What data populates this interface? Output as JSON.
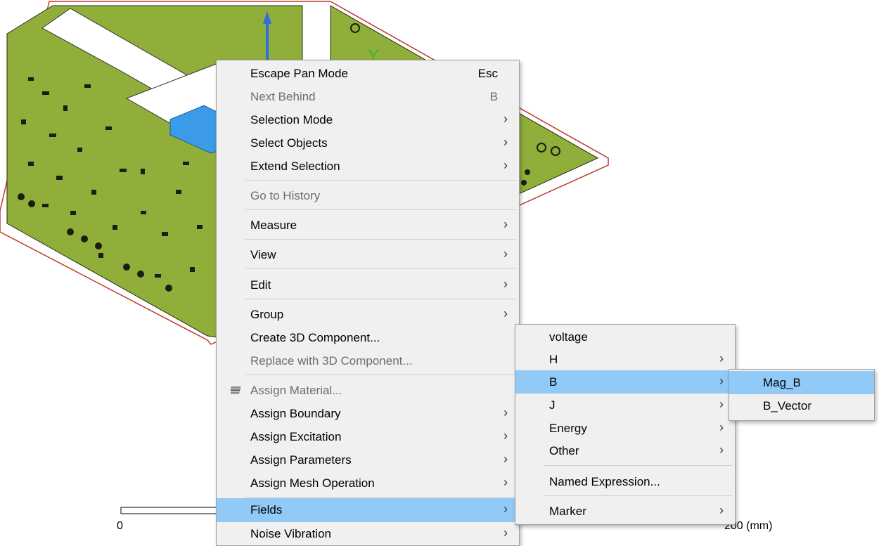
{
  "viewport": {
    "axis_label": "Y",
    "scale_start": "0",
    "scale_end": "200 (mm)"
  },
  "context_menu": {
    "items": [
      {
        "label": "Escape Pan Mode",
        "shortcut": "Esc",
        "enabled": true
      },
      {
        "label": "Next Behind",
        "shortcut": "B",
        "enabled": false
      },
      {
        "label": "Selection Mode",
        "submenu": true,
        "enabled": true
      },
      {
        "label": "Select Objects",
        "submenu": true,
        "enabled": true
      },
      {
        "label": "Extend Selection",
        "submenu": true,
        "enabled": true
      },
      {
        "label": "Go to History",
        "enabled": false
      },
      {
        "label": "Measure",
        "submenu": true,
        "enabled": true
      },
      {
        "label": "View",
        "submenu": true,
        "enabled": true
      },
      {
        "label": "Edit",
        "submenu": true,
        "enabled": true
      },
      {
        "label": "Group",
        "submenu": true,
        "enabled": true
      },
      {
        "label": "Create 3D Component...",
        "enabled": true
      },
      {
        "label": "Replace with 3D Component...",
        "enabled": false
      },
      {
        "label": "Assign Material...",
        "enabled": false,
        "icon": "material-icon"
      },
      {
        "label": "Assign Boundary",
        "submenu": true,
        "enabled": true
      },
      {
        "label": "Assign Excitation",
        "submenu": true,
        "enabled": true
      },
      {
        "label": "Assign Parameters",
        "submenu": true,
        "enabled": true
      },
      {
        "label": "Assign Mesh Operation",
        "submenu": true,
        "enabled": true
      },
      {
        "label": "Fields",
        "submenu": true,
        "enabled": true,
        "highlighted": true
      },
      {
        "label": "Noise Vibration",
        "submenu": true,
        "enabled": true
      }
    ]
  },
  "fields_submenu": {
    "items": [
      {
        "label": "voltage"
      },
      {
        "label": "H",
        "submenu": true
      },
      {
        "label": "B",
        "submenu": true,
        "highlighted": true
      },
      {
        "label": "J",
        "submenu": true
      },
      {
        "label": "Energy",
        "submenu": true
      },
      {
        "label": "Other",
        "submenu": true
      },
      {
        "label": "Named Expression..."
      },
      {
        "label": "Marker",
        "submenu": true
      }
    ]
  },
  "b_submenu": {
    "items": [
      {
        "label": "Mag_B",
        "highlighted": true
      },
      {
        "label": "B_Vector"
      }
    ]
  },
  "colors": {
    "highlight": "#91c9f7",
    "menu_bg": "#f0f0f0",
    "board_green": "#8fae3a",
    "board_outline": "#c0392b",
    "axis_z": "#2f6fe0",
    "axis_y": "#3bb53b",
    "component_blue": "#3b9be8"
  }
}
